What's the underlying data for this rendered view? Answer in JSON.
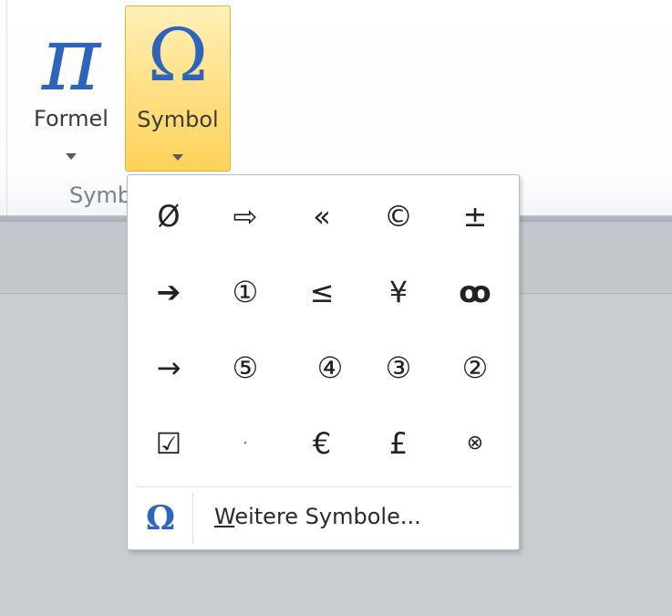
{
  "ribbon": {
    "buttons": {
      "formel": {
        "glyph": "π",
        "label": "Formel"
      },
      "symbol": {
        "glyph": "Ω",
        "label": "Symbol"
      }
    },
    "group_label": "Symb"
  },
  "colors": {
    "ribbon_icon_blue": "#2e64ba",
    "symbol_button_highlight": "#ffd35a",
    "workspace_gray": "#c3c6cb"
  },
  "dropdown": {
    "symbols": [
      [
        "Ø",
        "⇨",
        "«",
        "©",
        "±"
      ],
      [
        "➔",
        "①",
        "≤",
        "¥",
        "ꝏ"
      ],
      [
        "→",
        "⑤",
        "④",
        "③",
        "②"
      ],
      [
        "☑",
        "·",
        "€",
        "£",
        "⊗"
      ]
    ],
    "more_icon": "Ω",
    "more_label_accel": "W",
    "more_label_rest": "eitere Symbole..."
  }
}
